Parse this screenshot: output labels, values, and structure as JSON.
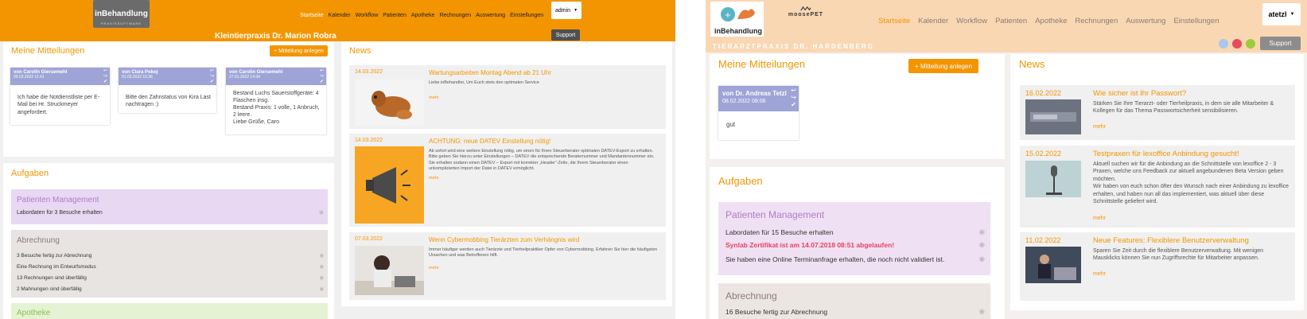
{
  "left": {
    "brand": {
      "logo": "inBehandlung",
      "sub": "PRAXISSOFTWARE"
    },
    "nav": [
      "Startseite",
      "Kalender",
      "Workflow",
      "Patienten",
      "Apotheke",
      "Rechnungen",
      "Auswertung",
      "Einstellungen"
    ],
    "user": "admin",
    "clinic": "Kleintierpraxis Dr. Marion Robra",
    "support": "Support",
    "messages_title": "Meine Mitteilungen",
    "add_message": "+ Mitteilung anlegen",
    "messages": [
      {
        "from": "von Carolin Giersemehl",
        "date": "09.03.2022 11:41",
        "body": "Ich habe die Notdienstliste per E-Mail bei Hr. Struckmeyer angefordert."
      },
      {
        "from": "von Clara Pokoj",
        "date": "01.03.2022 15:36",
        "body": "Bitte den Zahnstatus von Kira Last nachtragen :)"
      },
      {
        "from": "von Carolin Giersemehl",
        "date": "27.01.2022 14:34",
        "body": "Bestand Luchs Sauerstoffgeräte: 4 Flaschen insg.\nBestand Praxis: 1 volle, 1 Anbruch, 2 leere.\nLiebe Grüße, Caro"
      }
    ],
    "tasks_title": "Aufgaben",
    "tasks": [
      {
        "title": "Patienten Management",
        "color": "#e8d8f2",
        "titlecolor": "#b07cc6",
        "rows": [
          "Labordaten für 3 Besuche erhalten"
        ]
      },
      {
        "title": "Abrechnung",
        "color": "#e8e4e2",
        "titlecolor": "#8b7d75",
        "rows": [
          "3 Besuche fertig zur Abrechnung",
          "Eine Rechnung im Entwurfsmodus",
          "13 Rechnungen sind überfällig",
          "2 Mahnungen sind überfällig"
        ]
      },
      {
        "title": "Apotheke",
        "color": "#e5f3d4",
        "titlecolor": "#8cc152",
        "rows": []
      }
    ],
    "news_title": "News",
    "news": [
      {
        "date": "14.03.2022",
        "title": "Wartungsarbeiten Montag Abend ab 21 Uhr",
        "text": "Liebe inBehandler, Um Euch stets den optimalen Service",
        "more": "mehr"
      },
      {
        "date": "14.03.2022",
        "title": "ACHTUNG: neue DATEV Einstellung nötig!",
        "text": "Ab sofort wird eine weitere Einstellung nötig, um einen für Ihren Steuerberater optimalen DATEV-Export zu erhalten. Bitte geben Sie hierzu unter Einstellungen – DATEV die entsprechende Beraternummer und Mandantennummer ein. Sie erhalten sodann einen DATEV – Export mit korrekter „Header“-Zeile, die Ihrem Steuerberater einen unkomplizierten Import der Datei in DATEV ermöglicht.",
        "more": "mehr"
      },
      {
        "date": "07.03.2022",
        "title": "Wenn Cybermobbing Tierärzten zum Verhängnis wird",
        "text": "Immer häufiger werden auch Tierärzte und Tierheilpraktiker Opfer von Cybermobbing. Erfahren Sie hier die häufigsten Ursachen und was Betroffenen hilft.",
        "more": "mehr"
      }
    ]
  },
  "right": {
    "brand": {
      "logo": "inBehandlung",
      "partner": "moosePET"
    },
    "nav": [
      "Startseite",
      "Kalender",
      "Workflow",
      "Patienten",
      "Apotheke",
      "Rechnungen",
      "Auswertung",
      "Einstellungen"
    ],
    "user": "atetzl",
    "clinic": "TIERARZTPRAXIS DR. HARDENBERG",
    "support": "Support",
    "dots": [
      "#a8c8ef",
      "#e94b5b",
      "#9ccc3c"
    ],
    "messages_title": "Meine Mitteilungen",
    "add_message": "+ Mitteilung anlegen",
    "messages": [
      {
        "from": "von Dr. Andreas Tetzl",
        "date": "08.02.2022 08:06",
        "body": "gut"
      }
    ],
    "tasks_title": "Aufgaben",
    "tasks": [
      {
        "title": "Patienten Management",
        "color": "#f0e0f4",
        "titlecolor": "#b07cc6",
        "rows": [
          "Labordaten für 15 Besuche erhalten",
          "Synlab Zertifikat ist am 14.07.2018 08:51 abgelaufen!",
          "Sie haben eine Online Terminanfrage erhalten, die noch nicht validiert ist."
        ]
      },
      {
        "title": "Abrechnung",
        "color": "#ece6e2",
        "titlecolor": "#8b7d75",
        "rows": [
          "16 Besuche fertig zur Abrechnung"
        ]
      }
    ],
    "news_title": "News",
    "news": [
      {
        "date": "16.02.2022",
        "title": "Wie sicher ist Ihr Passwort?",
        "text": "Stärken Sie Ihre Tierarzt- oder Tierheilpraxis, in dem sie alle Mitarbeiter & Kollegen für das Thema Passwortsicherheit sensibilisieren.",
        "more": "mehr"
      },
      {
        "date": "15.02.2022",
        "title": "Testpraxen für lexoffice Anbindung gesucht!",
        "text": "Aktuell suchen wir für die Anbindung an die Schnittstelle von lexoffice 2 - 3 Praxen, welche uns Feedback zur aktuell angebundenen Beta Version geben möchten.\nWir haben von euch schon öfter den Wunsch nach einer Anbindung zu lexoffice erhalten, und haben nun all das implementiert, was aktuell über diese Schnittstelle geliefert wird.",
        "more": "mehr"
      },
      {
        "date": "11.02.2022",
        "title": "Neue Features: Flexiblere Benutzerverwaltung",
        "text": "Sparen Sie Zeit durch die flexiblere Benutzerverwaltung. Mit wenigen Mausklicks können Sie nun Zugriffsrechte für Mitarbeiter anpassen.",
        "more": "mehr"
      }
    ]
  },
  "colors": {
    "orange": "#f39500",
    "peach": "#f9d7b3",
    "lavender": "#9ea4d6"
  }
}
